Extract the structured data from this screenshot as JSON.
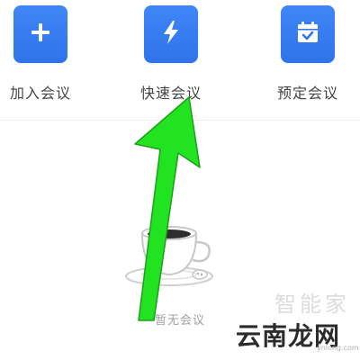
{
  "actions": {
    "join": {
      "label": "加入会议",
      "icon": "plus-icon"
    },
    "quick": {
      "label": "快速会议",
      "icon": "lightning-icon"
    },
    "schedule": {
      "label": "预定会议",
      "icon": "calendar-check-icon"
    }
  },
  "empty_state": {
    "text": "暂无会议",
    "illustration": "coffee-cup-icon"
  },
  "annotation": {
    "type": "arrow",
    "color": "#22e322",
    "points_to": "快速会议"
  },
  "watermark": {
    "top": "智能家",
    "main": "云南龙网",
    "sub": "ynlong.com"
  },
  "colors": {
    "accent": "#2f73ea",
    "label": "#444444",
    "muted": "#a0a0a0"
  }
}
